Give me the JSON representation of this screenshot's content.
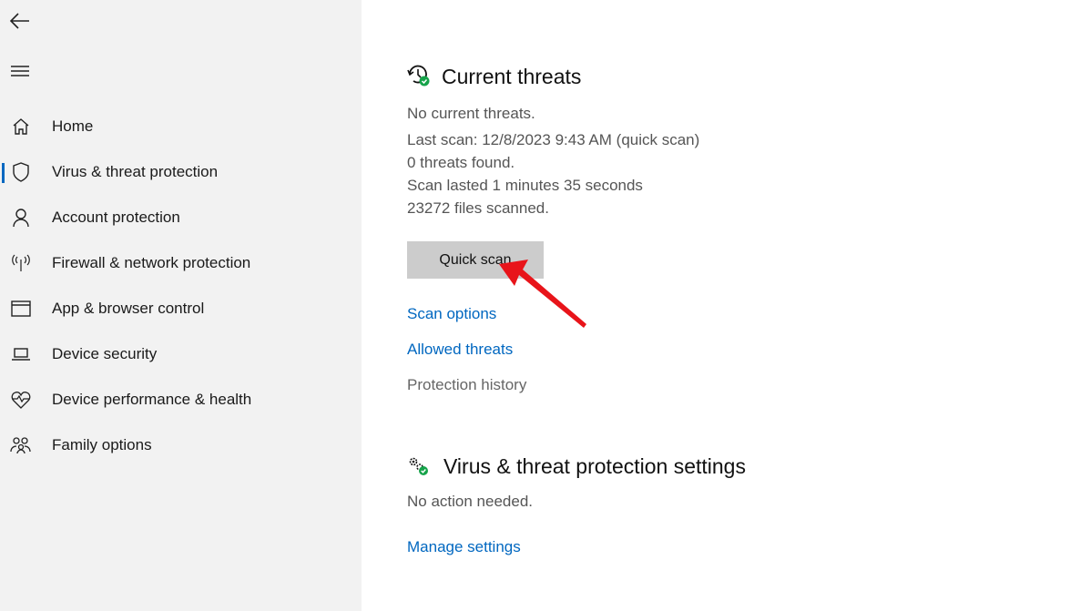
{
  "sidebar": {
    "back_icon": "back-arrow-icon",
    "menu_icon": "hamburger-menu-icon",
    "items": [
      {
        "label": "Home",
        "icon": "home-icon",
        "selected": false
      },
      {
        "label": "Virus & threat protection",
        "icon": "shield-icon",
        "selected": true
      },
      {
        "label": "Account protection",
        "icon": "person-icon",
        "selected": false
      },
      {
        "label": "Firewall & network protection",
        "icon": "antenna-icon",
        "selected": false
      },
      {
        "label": "App & browser control",
        "icon": "browser-window-icon",
        "selected": false
      },
      {
        "label": "Device security",
        "icon": "laptop-icon",
        "selected": false
      },
      {
        "label": "Device performance & health",
        "icon": "heart-pulse-icon",
        "selected": false
      },
      {
        "label": "Family options",
        "icon": "family-icon",
        "selected": false
      }
    ]
  },
  "current_threats": {
    "title": "Current threats",
    "status": "No current threats.",
    "last_scan": "Last scan: 12/8/2023 9:43 AM (quick scan)",
    "threats_found": "0 threats found.",
    "duration": "Scan lasted 1 minutes 35 seconds",
    "files_scanned": "23272 files scanned.",
    "quick_scan_label": "Quick scan",
    "scan_options_label": "Scan options",
    "allowed_threats_label": "Allowed threats",
    "protection_history_label": "Protection history"
  },
  "settings_section": {
    "title": "Virus & threat protection settings",
    "status": "No action needed.",
    "manage_label": "Manage settings"
  },
  "colors": {
    "accent": "#0067c0",
    "status_ok": "#16a34a",
    "annotation_arrow": "#e8141a"
  }
}
